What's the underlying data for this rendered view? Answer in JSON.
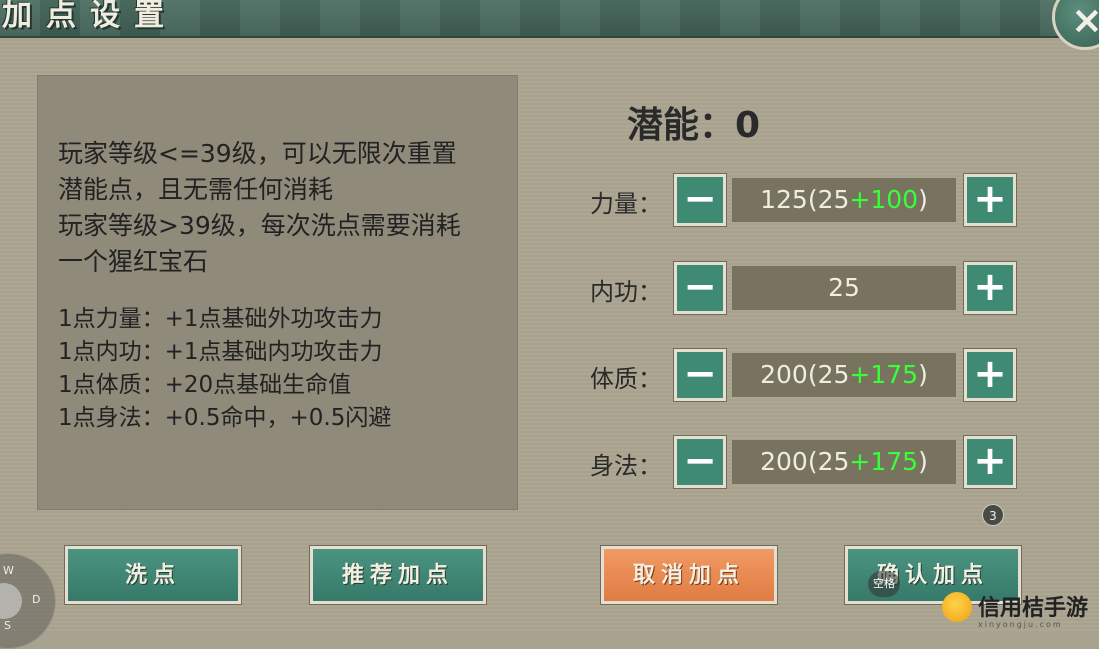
{
  "window": {
    "title": "加点设置",
    "close_icon": "×"
  },
  "description": {
    "lines": [
      "玩家等级<=39级，可以无限次重置",
      "潜能点，且无需任何消耗",
      "玩家等级>39级，每次洗点需要消耗",
      "一个猩红宝石"
    ],
    "effects": [
      "1点力量：+1点基础外功攻击力",
      "1点内功：+1点基础内功攻击力",
      "1点体质：+20点基础生命值",
      "1点身法：+0.5命中，+0.5闪避"
    ]
  },
  "potential": {
    "label": "潜能：",
    "value": "0"
  },
  "stats": [
    {
      "label": "力量：",
      "total": "125",
      "base": "25",
      "bonus": "+100"
    },
    {
      "label": "内功：",
      "total": "25",
      "base": "",
      "bonus": ""
    },
    {
      "label": "体质：",
      "total": "200",
      "base": "25",
      "bonus": "+175"
    },
    {
      "label": "身法：",
      "total": "200",
      "base": "25",
      "bonus": "+175"
    }
  ],
  "controls": {
    "minus": "−",
    "plus": "+"
  },
  "badge": "3",
  "buttons": {
    "reset": "洗点",
    "recommend": "推荐加点",
    "cancel": "取消加点",
    "confirm": "确认加点"
  },
  "overlay": {
    "joystick_keys": [
      "W",
      "D",
      "S"
    ],
    "space_key": "空格"
  },
  "watermark": {
    "text": "信用桔手游",
    "url": "xinyongju.com"
  },
  "colors": {
    "title_bar": "#3e5d52",
    "primary_button": "#3f8a73",
    "cancel_button": "#df7c43",
    "bonus_value": "#38ff3a",
    "value_box": "#77735f"
  }
}
